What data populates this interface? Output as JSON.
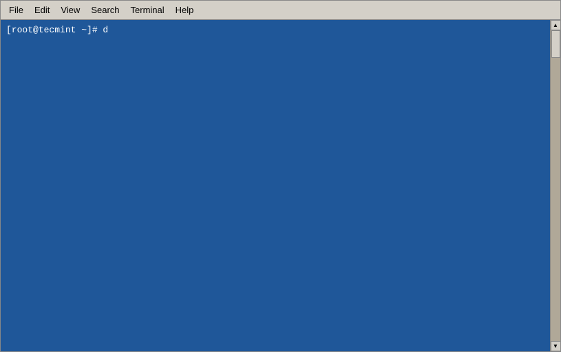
{
  "menubar": {
    "items": [
      {
        "id": "file",
        "label": "File"
      },
      {
        "id": "edit",
        "label": "Edit"
      },
      {
        "id": "view",
        "label": "View"
      },
      {
        "id": "search",
        "label": "Search"
      },
      {
        "id": "terminal",
        "label": "Terminal"
      },
      {
        "id": "help",
        "label": "Help"
      }
    ]
  },
  "terminal": {
    "background_color": "#1f5799",
    "prompt": "[root@tecmint ~]# d",
    "content_line": "[root@tecmint ~]# d"
  }
}
